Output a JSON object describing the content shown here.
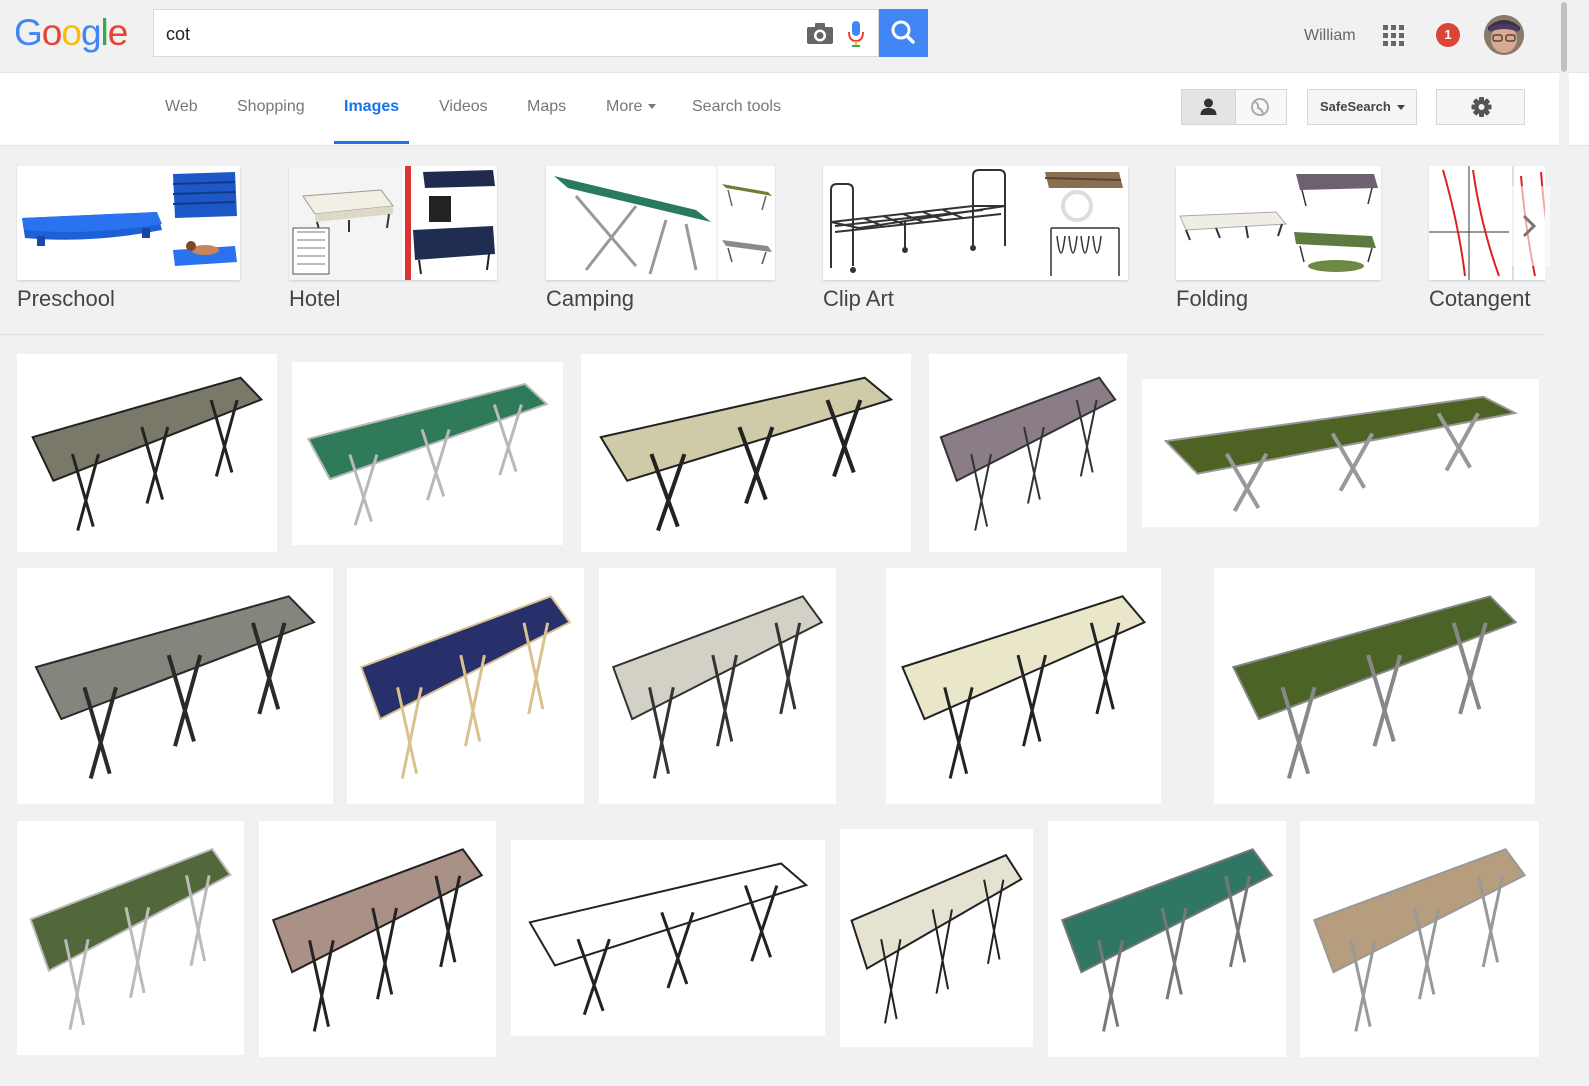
{
  "header": {
    "logo_letters": [
      "G",
      "o",
      "o",
      "g",
      "l",
      "e"
    ],
    "logo_colors": [
      "#4285f4",
      "#ea4335",
      "#fbbc05",
      "#4285f4",
      "#34a853",
      "#ea4335"
    ],
    "search_query": "cot",
    "user_name": "William",
    "notification_count": "1"
  },
  "nav": {
    "tabs": [
      "Web",
      "Shopping",
      "Images",
      "Videos",
      "Maps",
      "More",
      "Search tools"
    ],
    "active_tab": "Images",
    "safesearch_label": "SafeSearch"
  },
  "related_searches": [
    "Preschool",
    "Hotel",
    "Camping",
    "Clip Art",
    "Folding",
    "Cotangent"
  ],
  "results": [
    {
      "name": "folding-cot-grey",
      "color": "#7a7868",
      "frame": "#222222"
    },
    {
      "name": "folding-cot-green",
      "color": "#2f7a58",
      "frame": "#b9b9b9"
    },
    {
      "name": "folding-cot-beige",
      "color": "#cfcaa8",
      "frame": "#222222"
    },
    {
      "name": "folding-cot-plaid",
      "color": "#8a7d88",
      "frame": "#333333"
    },
    {
      "name": "folding-cot-olive",
      "color": "#4d6223",
      "frame": "#999999"
    },
    {
      "name": "folding-cot-grey-2",
      "color": "#85857d",
      "frame": "#2a2a2a"
    },
    {
      "name": "folding-cot-navy",
      "color": "#27306a",
      "frame": "#d9c28f"
    },
    {
      "name": "folding-cot-mattress",
      "color": "#d3d0c6",
      "frame": "#333333"
    },
    {
      "name": "folding-bed-striped",
      "color": "#e9e6c9",
      "frame": "#222222"
    },
    {
      "name": "folding-cot-olive-2",
      "color": "#4b6327",
      "frame": "#888888"
    },
    {
      "name": "folding-cot-green-2",
      "color": "#53683a",
      "frame": "#bbbbbb"
    },
    {
      "name": "folding-cot-taupe",
      "color": "#a99186",
      "frame": "#222222"
    },
    {
      "name": "bed-frame-clipart",
      "color": "#ffffff",
      "frame": "#222222"
    },
    {
      "name": "air-mattress-cot",
      "color": "#e6e2d2",
      "frame": "#222222"
    },
    {
      "name": "lounger-cot-teal",
      "color": "#2f7764",
      "frame": "#777777"
    },
    {
      "name": "folding-cot-tan",
      "color": "#b59d7d",
      "frame": "#999999"
    }
  ]
}
